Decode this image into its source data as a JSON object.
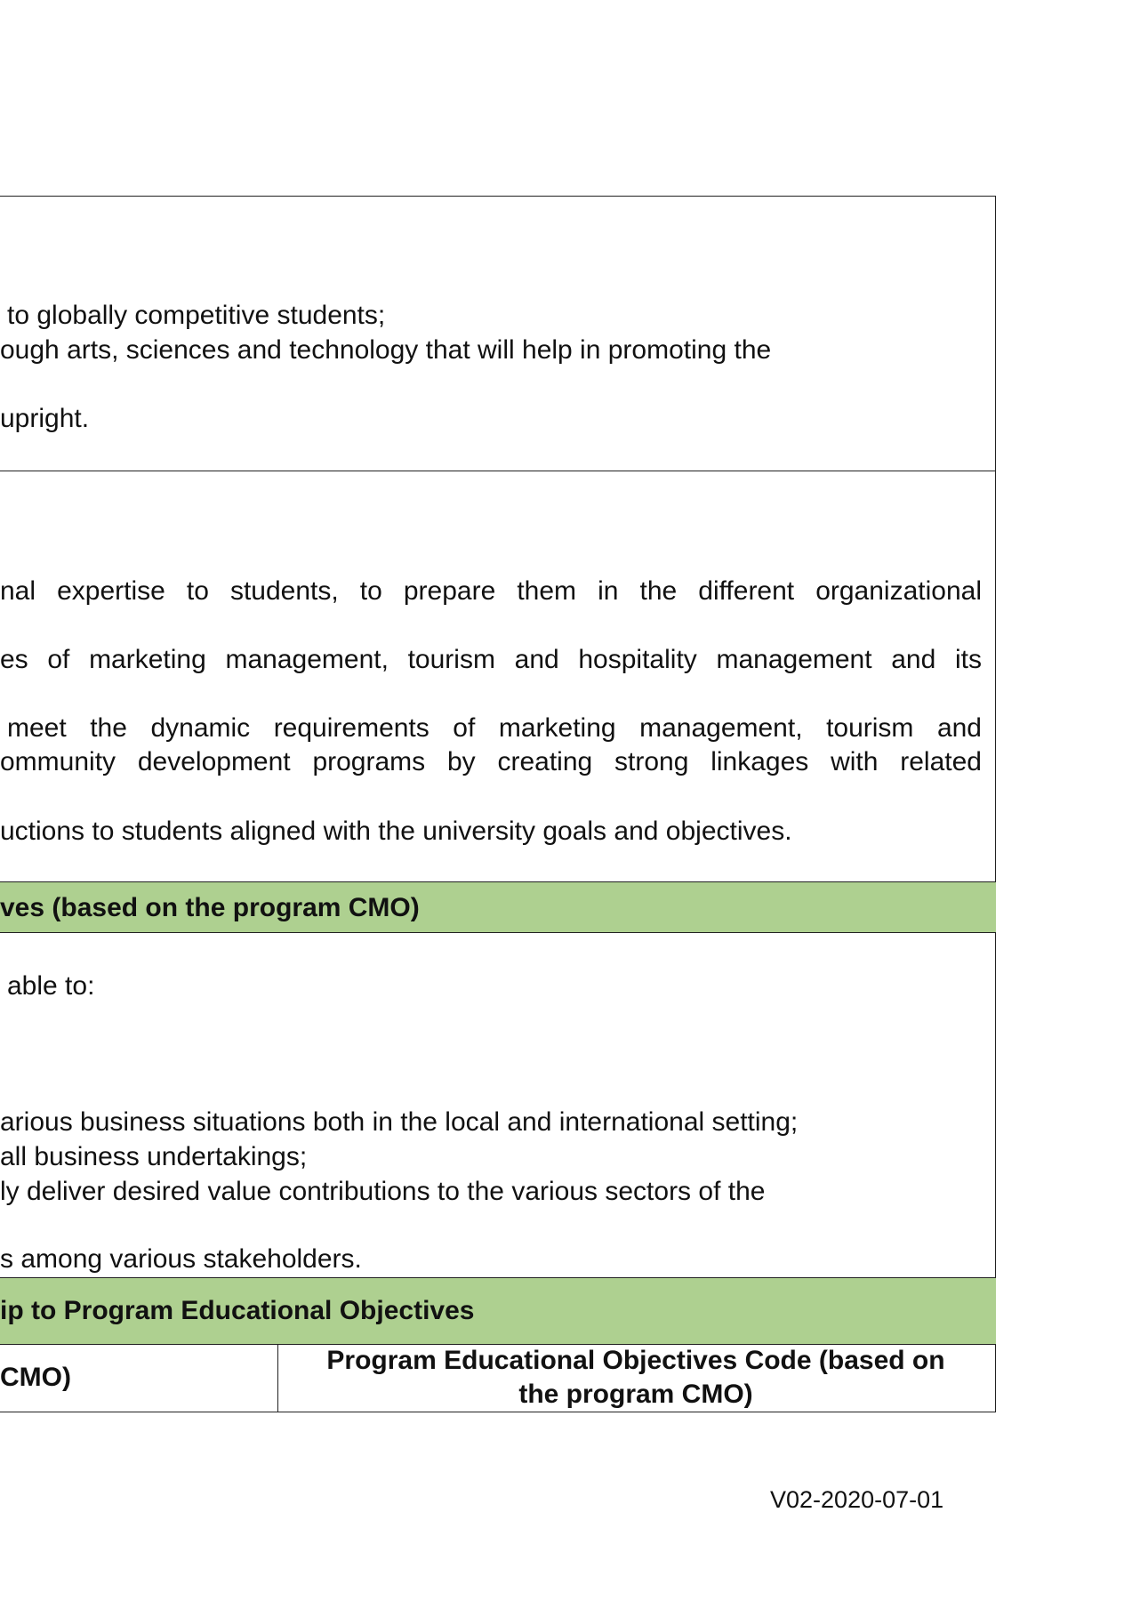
{
  "vision": {
    "lines": [
      "to globally competitive students;",
      "ough arts, sciences and technology that will help in promoting the",
      "upright."
    ]
  },
  "mission": {
    "lines": [
      "nal expertise to students, to prepare them in the different organizational",
      "es of marketing management, tourism and hospitality management and its",
      "meet the dynamic requirements of marketing management, tourism and",
      "ommunity development programs by creating strong linkages with related",
      "uctions to students aligned with the university goals and objectives."
    ]
  },
  "peo_header": "ves (based on the program CMO)",
  "peo": {
    "intro": "able to:",
    "lines": [
      "arious business situations both in the local and international setting;",
      "all business undertakings;",
      "ly deliver desired value contributions to the various sectors of the",
      "s among various stakeholders."
    ]
  },
  "relationship_header": "ip to Program Educational Objectives",
  "table_header": {
    "left": "CMO)",
    "right_line1": "Program Educational Objectives Code (based on",
    "right_line2": "the program CMO)"
  },
  "footer": {
    "version": "V02-2020-07-01"
  }
}
